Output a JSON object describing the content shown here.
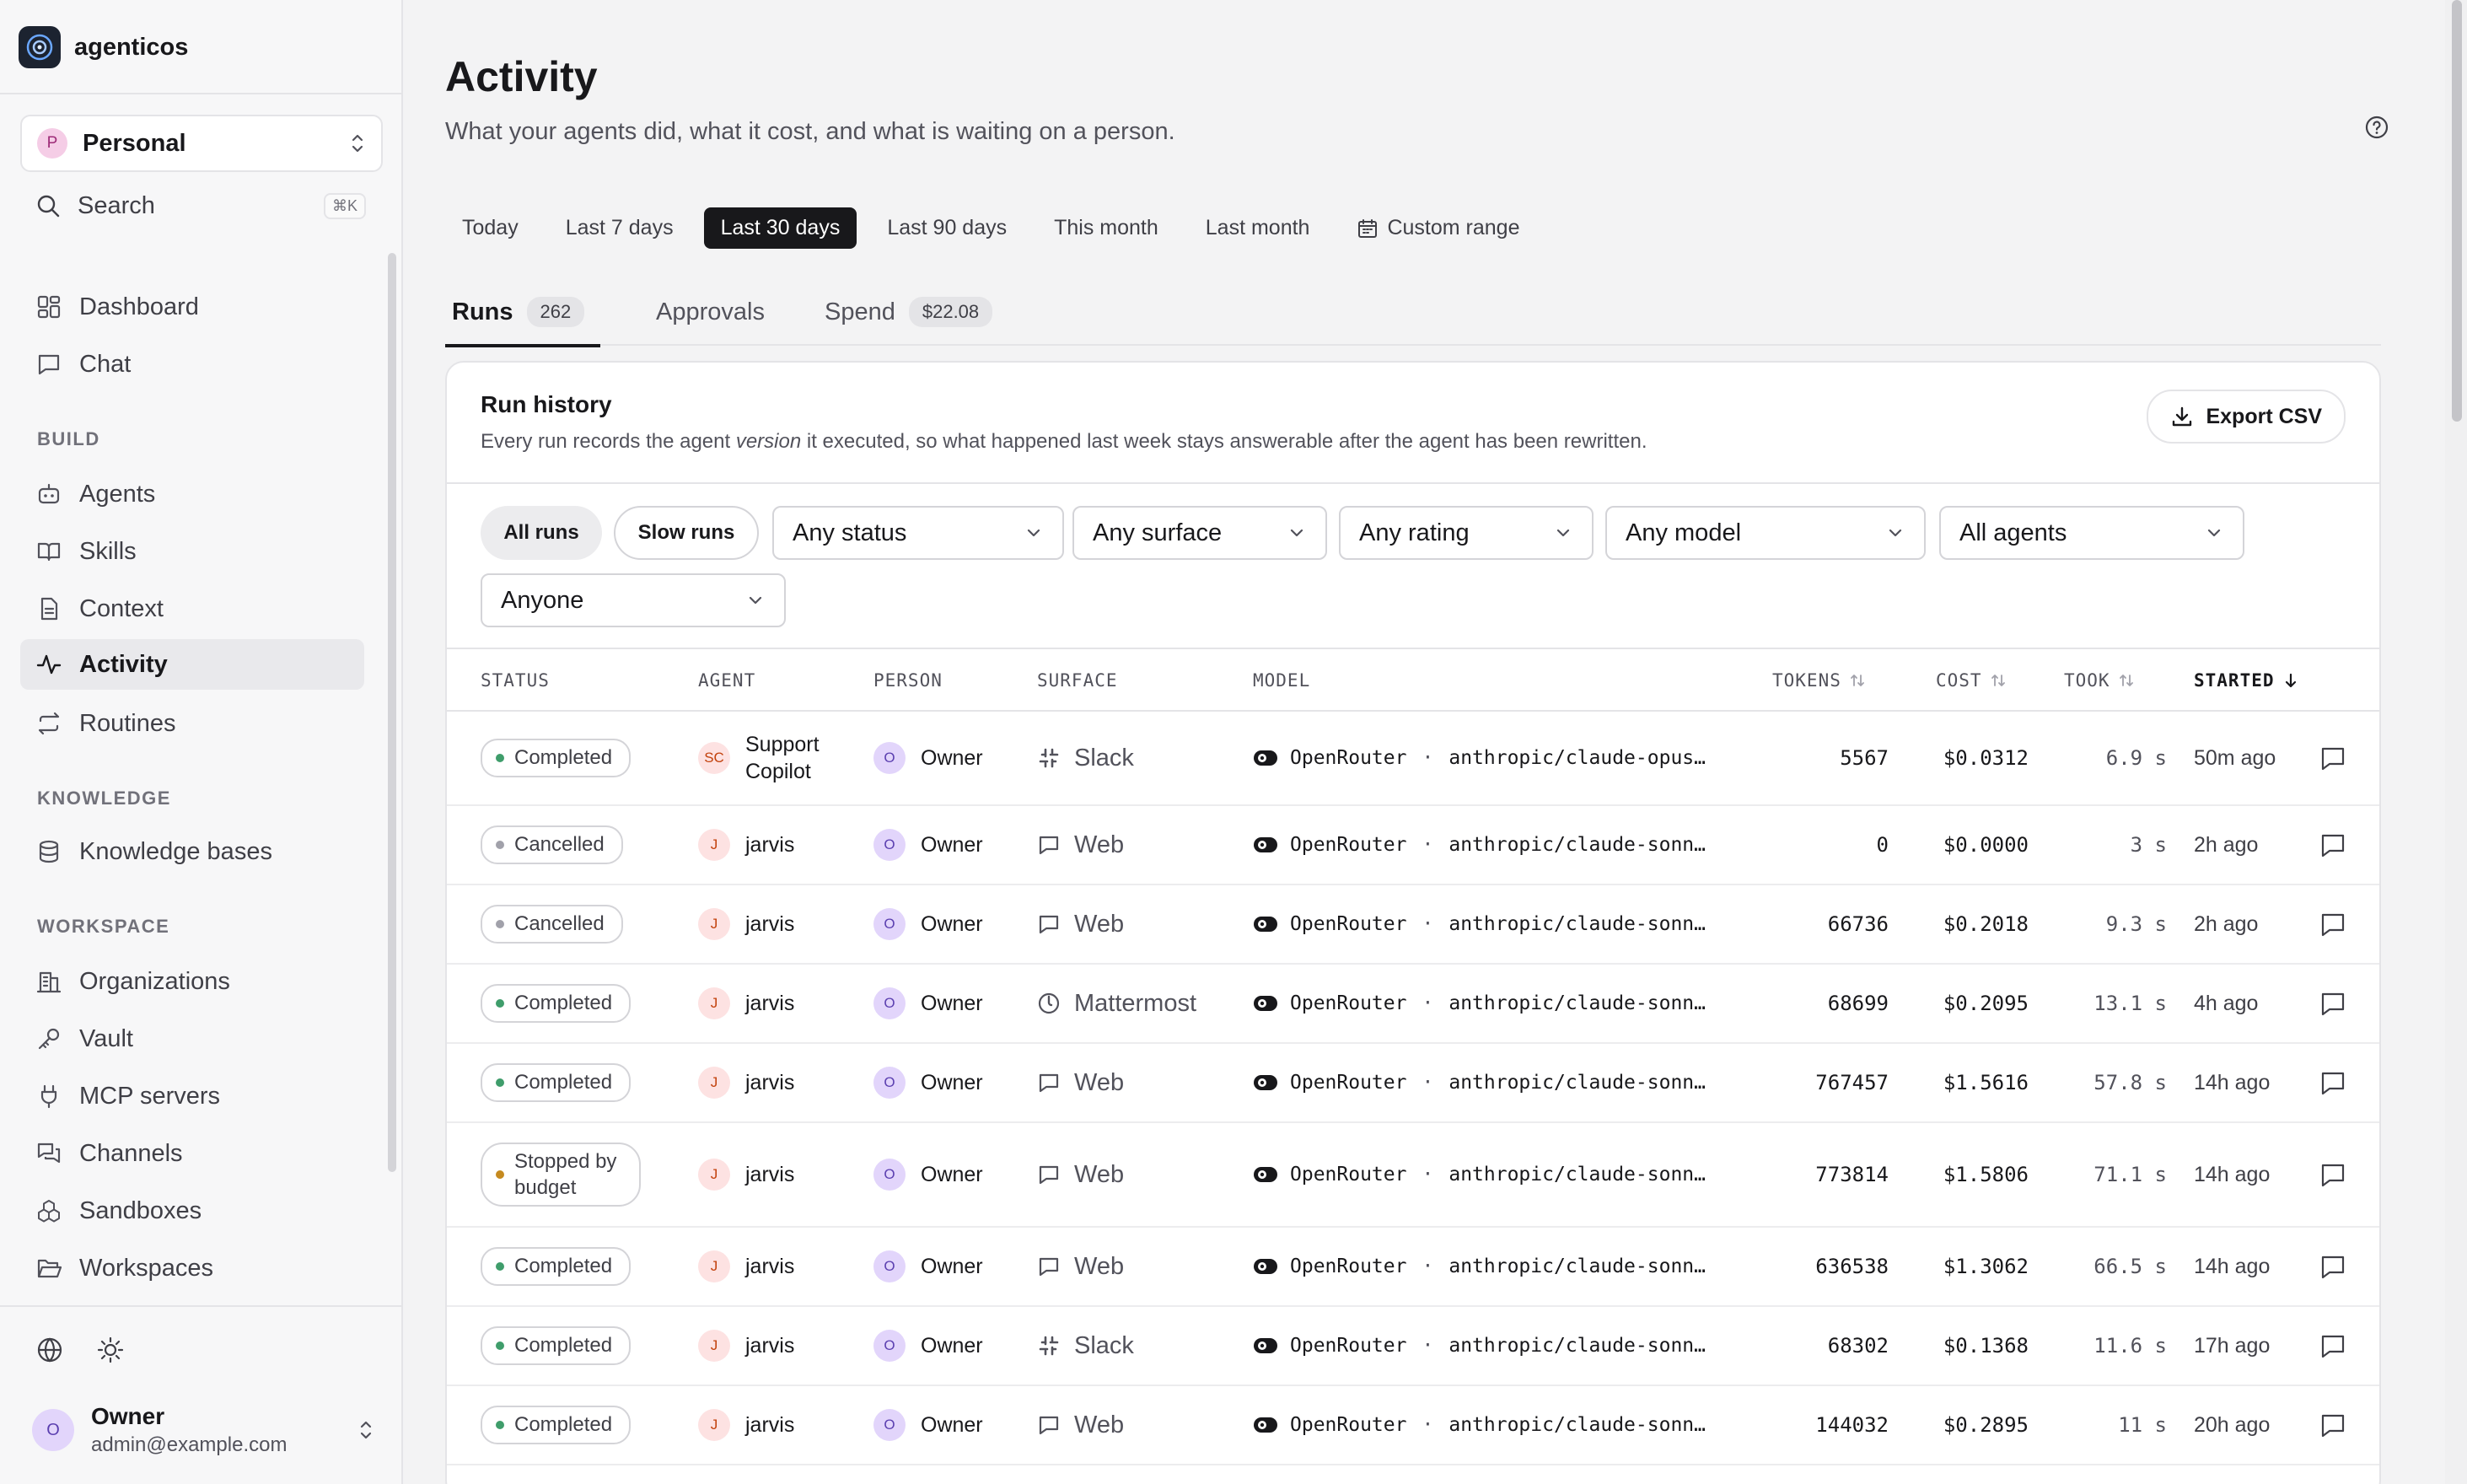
{
  "app": {
    "name": "agenticos"
  },
  "workspace": {
    "avatar": "P",
    "name": "Personal"
  },
  "search": {
    "label": "Search",
    "shortcut": "⌘K"
  },
  "nav": {
    "dashboard": "Dashboard",
    "chat": "Chat",
    "build_title": "BUILD",
    "agents": "Agents",
    "skills": "Skills",
    "context": "Context",
    "activity": "Activity",
    "routines": "Routines",
    "knowledge_title": "KNOWLEDGE",
    "knowledge_bases": "Knowledge bases",
    "workspace_title": "WORKSPACE",
    "organizations": "Organizations",
    "vault": "Vault",
    "mcp_servers": "MCP servers",
    "channels": "Channels",
    "sandboxes": "Sandboxes",
    "workspaces": "Workspaces"
  },
  "user": {
    "avatar": "O",
    "name": "Owner",
    "email": "admin@example.com"
  },
  "page": {
    "title": "Activity",
    "subtitle": "What your agents did, what it cost, and what is waiting on a person."
  },
  "ranges": {
    "today": "Today",
    "last7": "Last 7 days",
    "last30": "Last 30 days",
    "last90": "Last 90 days",
    "this_month": "This month",
    "last_month": "Last month",
    "custom": "Custom range",
    "selected": "Last 30 days"
  },
  "tabs": {
    "runs": "Runs",
    "runs_count": "262",
    "approvals": "Approvals",
    "spend": "Spend",
    "spend_total": "$22.08"
  },
  "run_history": {
    "title": "Run history",
    "desc_before": "Every run records the agent ",
    "desc_em": "version",
    "desc_after": " it executed, so what happened last week stays answerable after the agent has been rewritten.",
    "export_label": "Export CSV"
  },
  "filters": {
    "all_runs": "All runs",
    "slow_runs": "Slow runs",
    "status": "Any status",
    "surface": "Any surface",
    "rating": "Any rating",
    "model": "Any model",
    "agents": "All agents",
    "person": "Anyone"
  },
  "columns": {
    "status": "STATUS",
    "agent": "AGENT",
    "person": "PERSON",
    "surface": "SURFACE",
    "model": "MODEL",
    "tokens": "TOKENS",
    "cost": "COST",
    "took": "TOOK",
    "started": "STARTED"
  },
  "colors": {
    "completed": "#3f9d6b",
    "cancelled": "#a1a1aa",
    "budget": "#c58a1f",
    "accent": "#18181b"
  },
  "runs": [
    {
      "status": "Completed",
      "status_kind": "completed",
      "agent_avatar": "SC",
      "agent": "Support Copilot",
      "person_avatar": "O",
      "person": "Owner",
      "surface": "Slack",
      "surface_icon": "slack-icon",
      "provider": "OpenRouter",
      "model": "anthropic/claude-opus…",
      "tokens": "5567",
      "cost": "$0.0312",
      "took": "6.9 s",
      "started": "50m ago"
    },
    {
      "status": "Cancelled",
      "status_kind": "cancelled",
      "agent_avatar": "J",
      "agent": "jarvis",
      "person_avatar": "O",
      "person": "Owner",
      "surface": "Web",
      "surface_icon": "chat-bubble-icon",
      "provider": "OpenRouter",
      "model": "anthropic/claude-sonn…",
      "tokens": "0",
      "cost": "$0.0000",
      "took": "3 s",
      "started": "2h ago"
    },
    {
      "status": "Cancelled",
      "status_kind": "cancelled",
      "agent_avatar": "J",
      "agent": "jarvis",
      "person_avatar": "O",
      "person": "Owner",
      "surface": "Web",
      "surface_icon": "chat-bubble-icon",
      "provider": "OpenRouter",
      "model": "anthropic/claude-sonn…",
      "tokens": "66736",
      "cost": "$0.2018",
      "took": "9.3 s",
      "started": "2h ago"
    },
    {
      "status": "Completed",
      "status_kind": "completed",
      "agent_avatar": "J",
      "agent": "jarvis",
      "person_avatar": "O",
      "person": "Owner",
      "surface": "Mattermost",
      "surface_icon": "mattermost-icon",
      "provider": "OpenRouter",
      "model": "anthropic/claude-sonn…",
      "tokens": "68699",
      "cost": "$0.2095",
      "took": "13.1 s",
      "started": "4h ago"
    },
    {
      "status": "Completed",
      "status_kind": "completed",
      "agent_avatar": "J",
      "agent": "jarvis",
      "person_avatar": "O",
      "person": "Owner",
      "surface": "Web",
      "surface_icon": "chat-bubble-icon",
      "provider": "OpenRouter",
      "model": "anthropic/claude-sonn…",
      "tokens": "767457",
      "cost": "$1.5616",
      "took": "57.8 s",
      "started": "14h ago"
    },
    {
      "status": "Stopped by budget",
      "status_kind": "budget",
      "agent_avatar": "J",
      "agent": "jarvis",
      "person_avatar": "O",
      "person": "Owner",
      "surface": "Web",
      "surface_icon": "chat-bubble-icon",
      "provider": "OpenRouter",
      "model": "anthropic/claude-sonn…",
      "tokens": "773814",
      "cost": "$1.5806",
      "took": "71.1 s",
      "started": "14h ago"
    },
    {
      "status": "Completed",
      "status_kind": "completed",
      "agent_avatar": "J",
      "agent": "jarvis",
      "person_avatar": "O",
      "person": "Owner",
      "surface": "Web",
      "surface_icon": "chat-bubble-icon",
      "provider": "OpenRouter",
      "model": "anthropic/claude-sonn…",
      "tokens": "636538",
      "cost": "$1.3062",
      "took": "66.5 s",
      "started": "14h ago"
    },
    {
      "status": "Completed",
      "status_kind": "completed",
      "agent_avatar": "J",
      "agent": "jarvis",
      "person_avatar": "O",
      "person": "Owner",
      "surface": "Slack",
      "surface_icon": "slack-icon",
      "provider": "OpenRouter",
      "model": "anthropic/claude-sonn…",
      "tokens": "68302",
      "cost": "$0.1368",
      "took": "11.6 s",
      "started": "17h ago"
    },
    {
      "status": "Completed",
      "status_kind": "completed",
      "agent_avatar": "J",
      "agent": "jarvis",
      "person_avatar": "O",
      "person": "Owner",
      "surface": "Web",
      "surface_icon": "chat-bubble-icon",
      "provider": "OpenRouter",
      "model": "anthropic/claude-sonn…",
      "tokens": "144032",
      "cost": "$0.2895",
      "took": "11 s",
      "started": "20h ago"
    }
  ]
}
